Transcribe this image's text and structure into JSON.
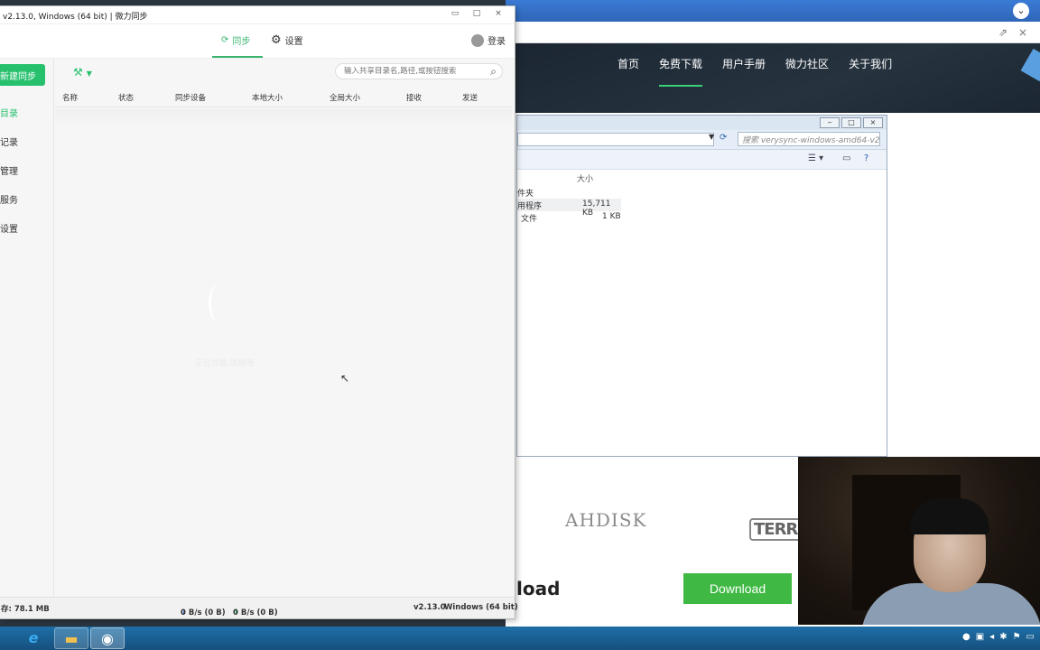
{
  "app": {
    "title": "v2.13.0, Windows (64 bit) | 微力同步",
    "controls": {
      "minimize": "▭",
      "maximize": "□",
      "close": "×"
    },
    "tabs": {
      "sync": "同步",
      "settings": "设置"
    },
    "login": "登录",
    "new_sync": "新建同步",
    "nav": [
      "目录",
      "记录",
      "管理",
      "服务",
      "设置"
    ],
    "tools_icon": "wrench-icon",
    "search_placeholder": "输入共享目录名,路径,或按钮搜索",
    "columns": [
      "名称",
      "状态",
      "同步设备",
      "本地大小",
      "全局大小",
      "接收",
      "发送"
    ],
    "loading_text": "正在加载,请稍等",
    "status": {
      "memory": "存: 78.1 MB",
      "download": "0 B/s (0 B)",
      "upload": "0 B/s (0 B)",
      "version": "v2.13.0",
      "platform": "Windows (64 bit)"
    }
  },
  "website": {
    "nav": [
      "首页",
      "免费下载",
      "用户手册",
      "微力社区",
      "关于我们"
    ],
    "active_nav": "免费下载",
    "brands": [
      "AHDISK",
      "TERRA"
    ],
    "download_heading": "load",
    "download_button": "Download"
  },
  "explorer": {
    "search_placeholder": "搜索 verysync-windows-amd64-v2....",
    "column_size": "大小",
    "rows": [
      {
        "type": "件夹",
        "size": ""
      },
      {
        "type": "用程序",
        "size": "15,711 KB"
      },
      {
        "type": "文件",
        "size": "1 KB"
      }
    ]
  },
  "colors": {
    "accent": "#27c16e",
    "download_button": "#3fb944",
    "taskbar": "#1e6fa7"
  }
}
